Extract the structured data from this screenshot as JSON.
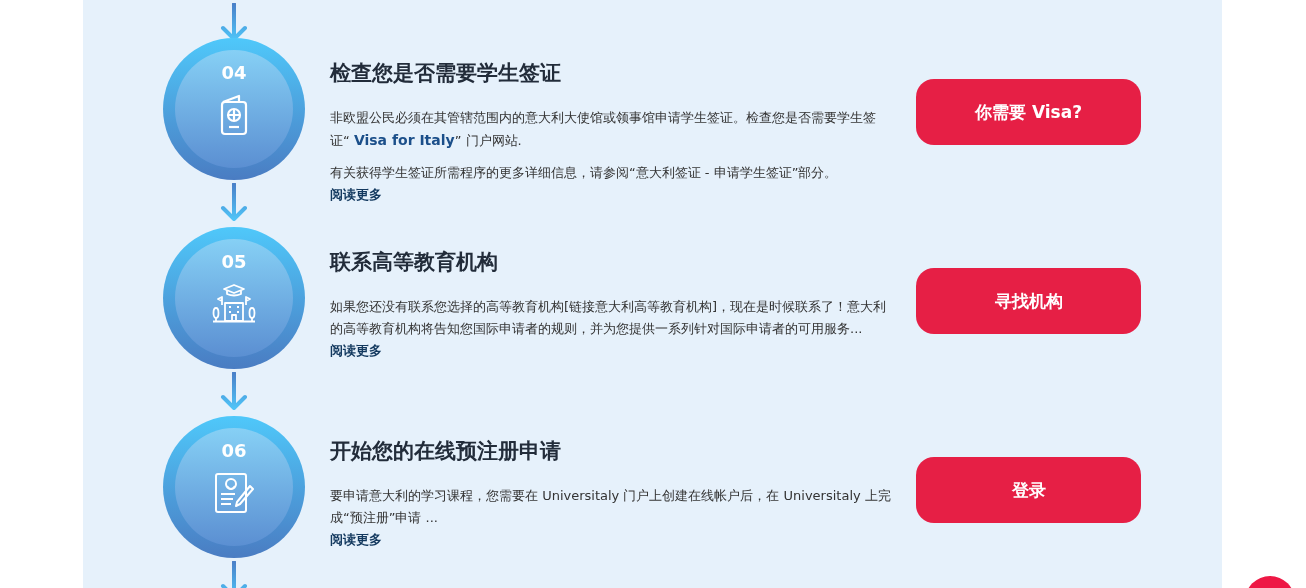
{
  "steps": [
    {
      "number": "04",
      "kind": "passport",
      "title": "检查您是否需要学生签证",
      "paragraphs": [
        [
          {
            "kind": "text",
            "text": "非欧盟公民必须在其管辖范围内的意大利大使馆或领事馆申请学生签证。检查您是否需要学生签证“ "
          },
          {
            "kind": "link",
            "text": "Visa for Italy"
          },
          {
            "kind": "text",
            "text": "” 门户网站."
          }
        ],
        [
          {
            "kind": "text",
            "text": "有关获得学生签证所需程序的更多详细信息，请参阅“意大利签证 - 申请学生签证”部分。"
          }
        ]
      ],
      "read_more": "阅读更多",
      "button": "你需要 Visa?"
    },
    {
      "number": "05",
      "kind": "university",
      "title": "联系高等教育机构",
      "paragraphs": [
        [
          {
            "kind": "text",
            "text": "如果您还没有联系您选择的高等教育机构[链接意大利高等教育机构]，现在是时候联系了！意大利的高等教育机构将告知您国际申请者的规则，并为您提供一系列针对国际申请者的可用服务..."
          }
        ]
      ],
      "read_more": "阅读更多",
      "button": "寻找机构"
    },
    {
      "number": "06",
      "kind": "form",
      "title": "开始您的在线预注册申请",
      "paragraphs": [
        [
          {
            "kind": "text",
            "text": "要申请意大利的学习课程，您需要在 Universitaly 门户上创建在线帐户后，在 Universitaly 上完成“预注册”申请 ..."
          }
        ]
      ],
      "read_more": "阅读更多",
      "button": "登录"
    }
  ]
}
